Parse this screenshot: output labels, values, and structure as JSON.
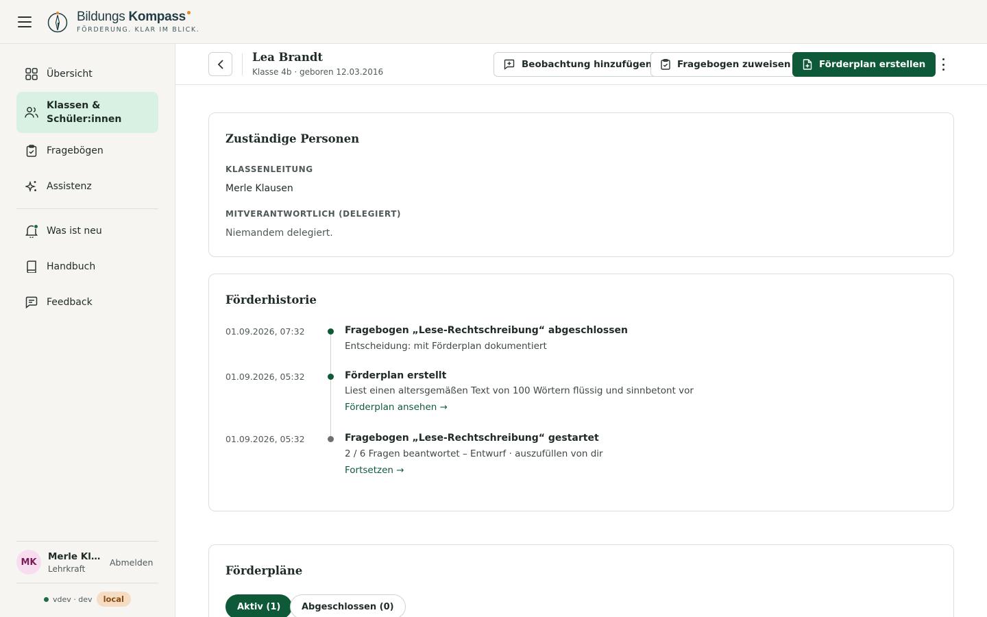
{
  "brand": {
    "name_light": "Bildungs",
    "name_bold": "Kompass",
    "tagline": "FÖRDERUNG. KLAR IM BLICK.",
    "accent_color": "#e08a2c"
  },
  "colors": {
    "primary": "#0e5a38",
    "active_nav_bg": "#d8f1e3",
    "sidebar_bg": "#f6f5f2"
  },
  "sidebar": {
    "items": [
      {
        "label": "Übersicht",
        "icon": "grid-icon"
      },
      {
        "label": "Klassen &\nSchüler:innen",
        "icon": "users-icon",
        "active": true
      },
      {
        "label": "Fragebögen",
        "icon": "clipboard-check-icon"
      },
      {
        "label": "Assistenz",
        "icon": "sparkles-icon"
      }
    ],
    "secondary_items": [
      {
        "label": "Was ist neu",
        "icon": "bell-icon"
      },
      {
        "label": "Handbuch",
        "icon": "book-icon"
      },
      {
        "label": "Feedback",
        "icon": "message-icon"
      }
    ],
    "user": {
      "initials": "MK",
      "name": "Merle Klausen",
      "role": "Lehrkraft",
      "logout_label": "Abmelden"
    },
    "env": {
      "version": "vdev · dev",
      "badge": "local"
    }
  },
  "header": {
    "student_name": "Lea Brandt",
    "student_meta": "Klasse 4b · geboren 12.03.2016",
    "btn_observation": "Beobachtung hinzufügen",
    "btn_questionnaire": "Fragebogen zuweisen",
    "btn_plan": "Förderplan erstellen"
  },
  "responsible": {
    "title": "Zuständige Personen",
    "class_lead_label": "Klassenleitung",
    "class_lead_value": "Merle Klausen",
    "delegated_label": "Mitverantwortlich (delegiert)",
    "delegated_value": "Niemandem delegiert."
  },
  "history": {
    "title": "Förderhistorie",
    "entries": [
      {
        "time": "01.09.2026, 07:32",
        "title": "Fragebogen „Lese-Rechtschreibung“ abgeschlossen",
        "desc": "Entscheidung: mit Förderplan dokumentiert",
        "link": ""
      },
      {
        "time": "01.09.2026, 05:32",
        "title": "Förderplan erstellt",
        "desc": "Liest einen altersgemäßen Text von 100 Wörtern flüssig und sinnbetont vor",
        "link": "Förderplan ansehen →"
      },
      {
        "time": "01.09.2026, 05:32",
        "title": "Fragebogen „Lese-Rechtschreibung“ gestartet",
        "desc": "2 / 6 Fragen beantwortet – Entwurf · auszufüllen von dir",
        "link": "Fortsetzen →"
      }
    ]
  },
  "plans": {
    "title": "Förderpläne",
    "tab_active": "Aktiv (1)",
    "tab_closed": "Abgeschlossen (0)"
  }
}
